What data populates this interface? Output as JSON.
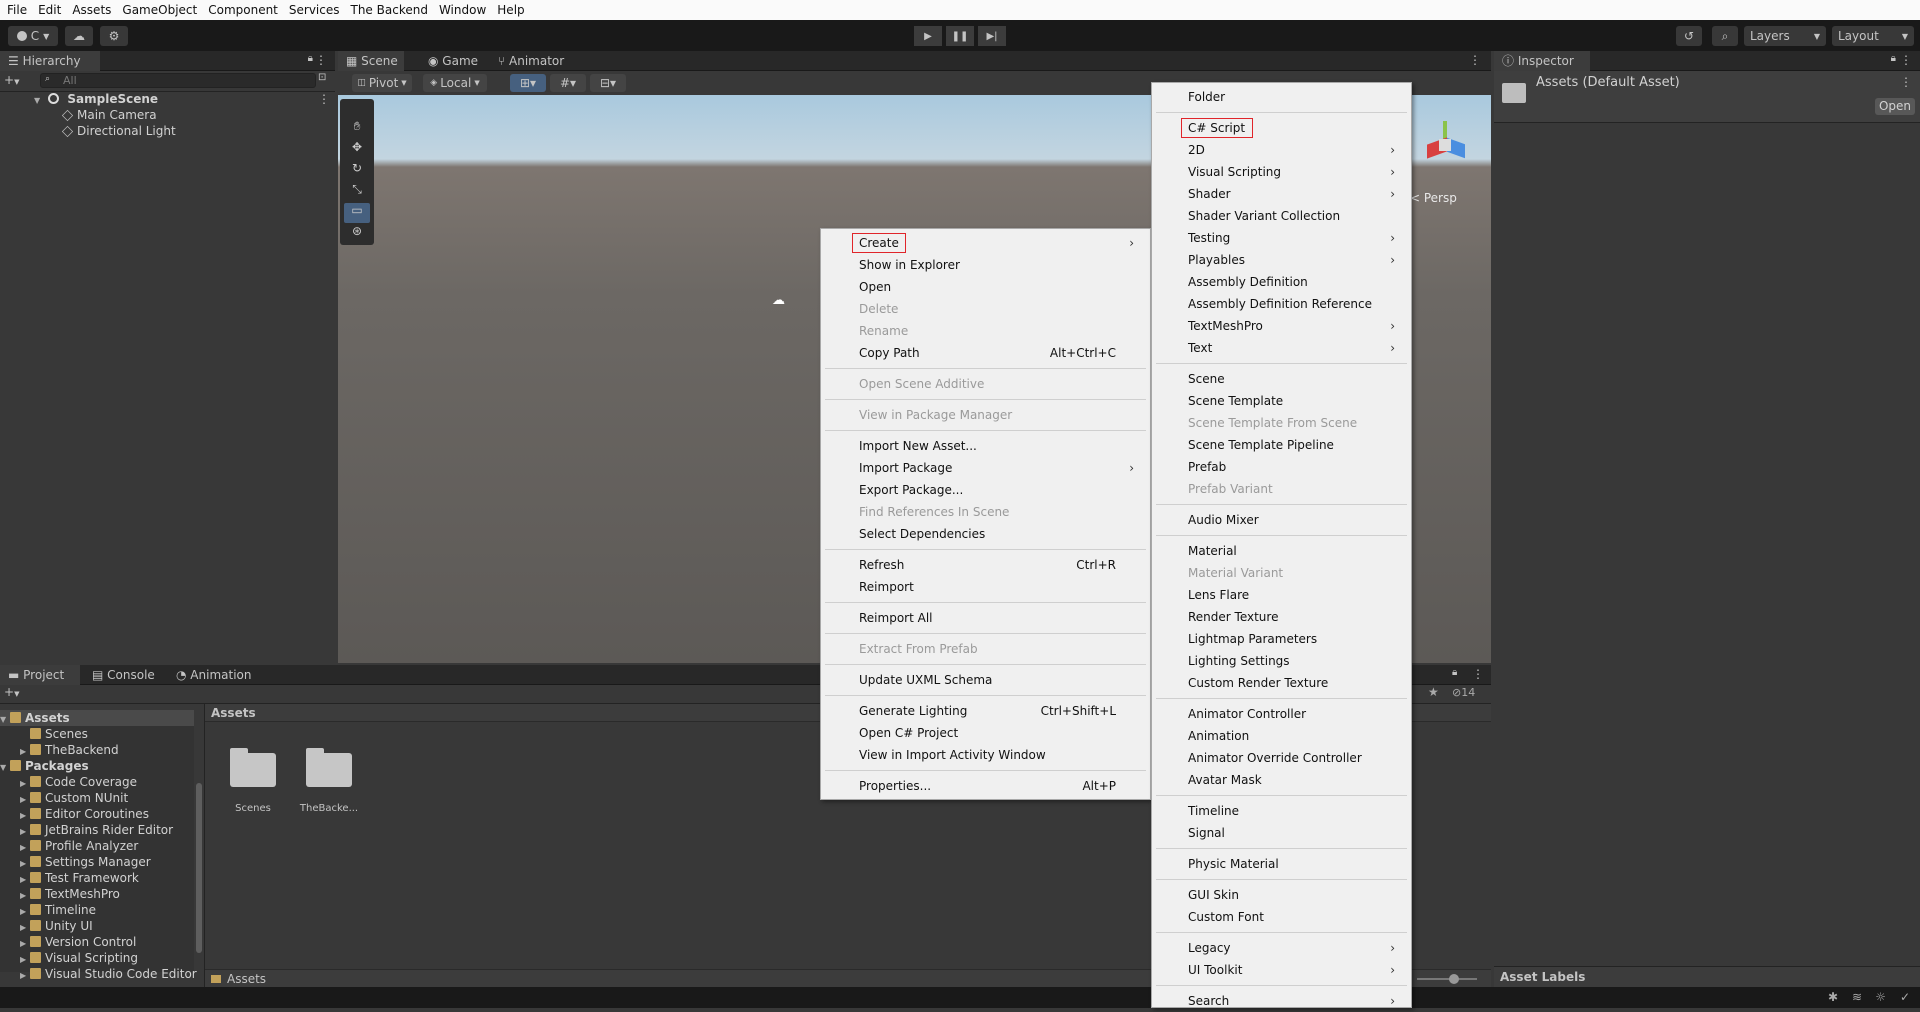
{
  "menubar": [
    "File",
    "Edit",
    "Assets",
    "GameObject",
    "Component",
    "Services",
    "The Backend",
    "Window",
    "Help"
  ],
  "toolbar": {
    "account": "C",
    "layers": "Layers",
    "layout": "Layout"
  },
  "hierarchy": {
    "tab": "Hierarchy",
    "search_placeholder": "All",
    "items": [
      {
        "label": "SampleScene",
        "level": 0
      },
      {
        "label": "Main Camera",
        "level": 1
      },
      {
        "label": "Directional Light",
        "level": 1
      }
    ]
  },
  "scene_tabs": [
    "Scene",
    "Game",
    "Animator"
  ],
  "scene_toolbar": {
    "pivot": "Pivot",
    "local": "Local",
    "persp": "< Persp"
  },
  "inspector": {
    "tab": "Inspector",
    "title": "Assets (Default Asset)",
    "open_button": "Open",
    "asset_labels": "Asset Labels"
  },
  "bottom_tabs": [
    "Project",
    "Console",
    "Animation"
  ],
  "project": {
    "hidden_count": "14",
    "tree": [
      {
        "label": "Assets",
        "level": 0,
        "bold": true
      },
      {
        "label": "Scenes",
        "level": 1
      },
      {
        "label": "TheBackend",
        "level": 1
      },
      {
        "label": "Packages",
        "level": 0,
        "bold": true
      },
      {
        "label": "Code Coverage",
        "level": 1
      },
      {
        "label": "Custom NUnit",
        "level": 1
      },
      {
        "label": "Editor Coroutines",
        "level": 1
      },
      {
        "label": "JetBrains Rider Editor",
        "level": 1
      },
      {
        "label": "Profile Analyzer",
        "level": 1
      },
      {
        "label": "Settings Manager",
        "level": 1
      },
      {
        "label": "Test Framework",
        "level": 1
      },
      {
        "label": "TextMeshPro",
        "level": 1
      },
      {
        "label": "Timeline",
        "level": 1
      },
      {
        "label": "Unity UI",
        "level": 1
      },
      {
        "label": "Version Control",
        "level": 1
      },
      {
        "label": "Visual Scripting",
        "level": 1
      },
      {
        "label": "Visual Studio Code Editor",
        "level": 1
      }
    ],
    "breadcrumb": "Assets",
    "footer_path": "Assets",
    "files": [
      "Scenes",
      "TheBacke..."
    ]
  },
  "context_menu": [
    {
      "label": "Create",
      "submenu": true,
      "highlight": true
    },
    {
      "label": "Show in Explorer"
    },
    {
      "label": "Open"
    },
    {
      "label": "Delete",
      "disabled": true
    },
    {
      "label": "Rename",
      "disabled": true
    },
    {
      "label": "Copy Path",
      "shortcut": "Alt+Ctrl+C"
    },
    {
      "sep": true
    },
    {
      "label": "Open Scene Additive",
      "disabled": true
    },
    {
      "sep": true
    },
    {
      "label": "View in Package Manager",
      "disabled": true
    },
    {
      "sep": true
    },
    {
      "label": "Import New Asset..."
    },
    {
      "label": "Import Package",
      "submenu": true
    },
    {
      "label": "Export Package..."
    },
    {
      "label": "Find References In Scene",
      "disabled": true
    },
    {
      "label": "Select Dependencies"
    },
    {
      "sep": true
    },
    {
      "label": "Refresh",
      "shortcut": "Ctrl+R"
    },
    {
      "label": "Reimport"
    },
    {
      "sep": true
    },
    {
      "label": "Reimport All"
    },
    {
      "sep": true
    },
    {
      "label": "Extract From Prefab",
      "disabled": true
    },
    {
      "sep": true
    },
    {
      "label": "Update UXML Schema"
    },
    {
      "sep": true
    },
    {
      "label": "Generate Lighting",
      "shortcut": "Ctrl+Shift+L"
    },
    {
      "label": "Open C# Project"
    },
    {
      "label": "View in Import Activity Window"
    },
    {
      "sep": true
    },
    {
      "label": "Properties...",
      "shortcut": "Alt+P"
    }
  ],
  "create_menu": [
    {
      "label": "Folder"
    },
    {
      "sep": true
    },
    {
      "label": "C# Script",
      "highlight": true
    },
    {
      "label": "2D",
      "submenu": true
    },
    {
      "label": "Visual Scripting",
      "submenu": true
    },
    {
      "label": "Shader",
      "submenu": true
    },
    {
      "label": "Shader Variant Collection"
    },
    {
      "label": "Testing",
      "submenu": true
    },
    {
      "label": "Playables",
      "submenu": true
    },
    {
      "label": "Assembly Definition"
    },
    {
      "label": "Assembly Definition Reference"
    },
    {
      "label": "TextMeshPro",
      "submenu": true
    },
    {
      "label": "Text",
      "submenu": true
    },
    {
      "sep": true
    },
    {
      "label": "Scene"
    },
    {
      "label": "Scene Template"
    },
    {
      "label": "Scene Template From Scene",
      "disabled": true
    },
    {
      "label": "Scene Template Pipeline"
    },
    {
      "label": "Prefab"
    },
    {
      "label": "Prefab Variant",
      "disabled": true
    },
    {
      "sep": true
    },
    {
      "label": "Audio Mixer"
    },
    {
      "sep": true
    },
    {
      "label": "Material"
    },
    {
      "label": "Material Variant",
      "disabled": true
    },
    {
      "label": "Lens Flare"
    },
    {
      "label": "Render Texture"
    },
    {
      "label": "Lightmap Parameters"
    },
    {
      "label": "Lighting Settings"
    },
    {
      "label": "Custom Render Texture"
    },
    {
      "sep": true
    },
    {
      "label": "Animator Controller"
    },
    {
      "label": "Animation"
    },
    {
      "label": "Animator Override Controller"
    },
    {
      "label": "Avatar Mask"
    },
    {
      "sep": true
    },
    {
      "label": "Timeline"
    },
    {
      "label": "Signal"
    },
    {
      "sep": true
    },
    {
      "label": "Physic Material"
    },
    {
      "sep": true
    },
    {
      "label": "GUI Skin"
    },
    {
      "label": "Custom Font"
    },
    {
      "sep": true
    },
    {
      "label": "Legacy",
      "submenu": true
    },
    {
      "label": "UI Toolkit",
      "submenu": true
    },
    {
      "sep": true
    },
    {
      "label": "Search",
      "submenu": true
    }
  ],
  "colors": {
    "accent": "#e0252a",
    "folder": "#c2a15a",
    "menu_bg": "#f0f0f0"
  }
}
